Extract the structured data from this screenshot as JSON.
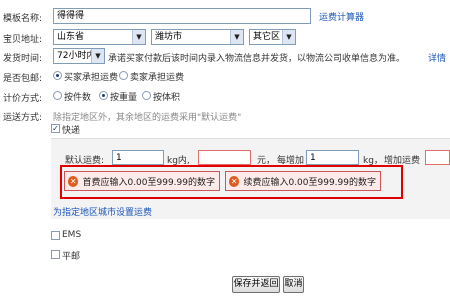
{
  "template": {
    "label": "模板名称:",
    "name_value": "得得得",
    "calc_link": "运费计算器"
  },
  "address": {
    "label": "宝贝地址:",
    "province": "山东省",
    "city": "潍坊市",
    "district": "其它区"
  },
  "ship_time": {
    "label": "发货时间:",
    "value": "72小时内",
    "note": "承诺买家付款后该时间内录入物流信息并发货，以物流公司收单信息为准。",
    "detail_link": "详情"
  },
  "free_shipping": {
    "label": "是否包邮:",
    "options": [
      "买家承担运费",
      "卖家承担运费"
    ],
    "selected": 0
  },
  "pricing": {
    "label": "计价方式:",
    "options": [
      "按件数",
      "按重量",
      "按体积"
    ],
    "selected": 1
  },
  "delivery": {
    "label": "运送方式:",
    "hint": "除指定地区外，其余地区的运费采用\"默认运费\"",
    "express_label": "快递",
    "express_checked": true,
    "default_fee_label": "默认运费:",
    "default_fee_value": "1",
    "unit_kg": "kg内,",
    "unit_yuan": "元，",
    "each_add_label": "每增加",
    "each_add_value": "1",
    "unit_kg2": "kg，",
    "add_fee_label": "增加运费",
    "errors": [
      "首费应输入0.00至999.99的数字",
      "续费应输入0.00至999.99的数字"
    ],
    "region_link": "为指定地区城市设置运费",
    "ems_label": "EMS",
    "ems_checked": false,
    "surface_label": "平邮",
    "surface_checked": false
  },
  "buttons": {
    "save": "保存并返回",
    "cancel": "取消"
  }
}
